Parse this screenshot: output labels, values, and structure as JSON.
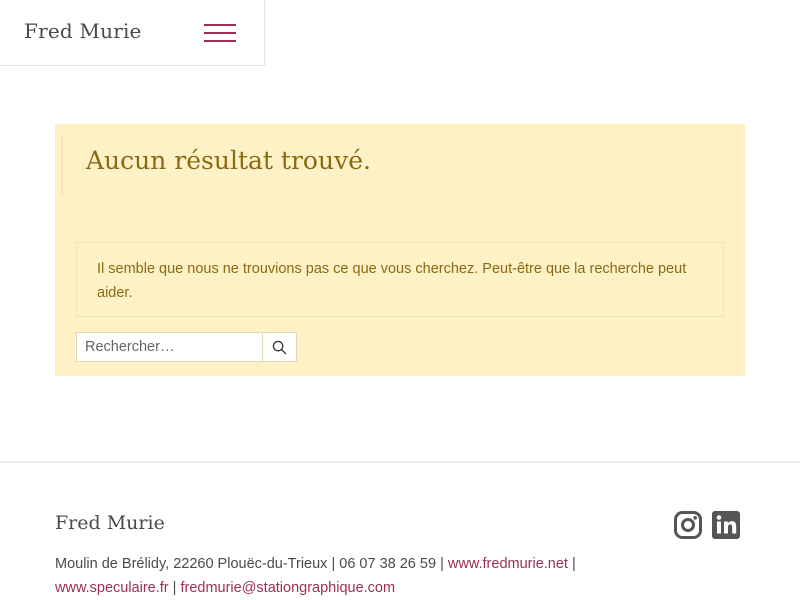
{
  "header": {
    "site_title": "Fred Murie",
    "menu_icon": "hamburger-menu-icon"
  },
  "notice": {
    "heading": "Aucun résultat trouvé.",
    "message": "Il semble que nous ne trouvions pas ce que vous cherchez. Peut-être que la recherche peut aider."
  },
  "search": {
    "placeholder": "Rechercher…",
    "button_icon": "search-icon"
  },
  "footer": {
    "title": "Fred Murie",
    "address": "Moulin de Brélidy, 22260 Plouëc-du-Trieux",
    "separator": "|",
    "phone": "06 07 38 26 59",
    "link_website": "www.fredmurie.net",
    "link_speculaire": "www.speculaire.fr",
    "email": "fredmurie@stationgraphique.com",
    "social_icons": [
      "instagram-icon",
      "linkedin-icon"
    ]
  },
  "colors": {
    "accent": "#9b2f55",
    "notice_background": "#fef1c6",
    "notice_text": "#8a6a12"
  }
}
